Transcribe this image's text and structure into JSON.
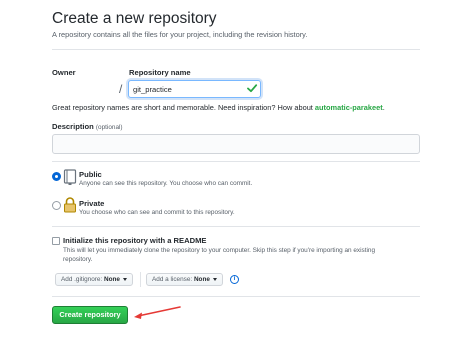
{
  "header": {
    "title": "Create a new repository",
    "subtitle": "A repository contains all the files for your project, including the revision history."
  },
  "owner": {
    "label": "Owner"
  },
  "repository": {
    "label": "Repository name",
    "separator": "/",
    "value": "git_practice",
    "hint_prefix": "Great repository names are short and memorable. Need inspiration? How about ",
    "suggestion": "automatic-parakeet",
    "hint_suffix": "."
  },
  "description": {
    "label": "Description",
    "optional": "(optional)",
    "value": ""
  },
  "visibility": {
    "selected": "public",
    "options": [
      {
        "title": "Public",
        "desc": "Anyone can see this repository. You choose who can commit."
      },
      {
        "title": "Private",
        "desc": "You choose who can see and commit to this repository."
      }
    ]
  },
  "readme": {
    "checked": false,
    "label": "Initialize this repository with a README",
    "desc": "This will let you immediately clone the repository to your computer. Skip this step if you're importing an existing repository."
  },
  "dropdowns": {
    "gitignore_prefix": "Add .gitignore:",
    "gitignore_value": "None",
    "license_prefix": "Add a license:",
    "license_value": "None"
  },
  "info_icon": {
    "glyph": "i"
  },
  "actions": {
    "create_label": "Create repository"
  },
  "colors": {
    "primary_button": "#28a745",
    "suggestion": "#28a745",
    "focus_border": "#79b8ff",
    "arrow": "#e53935"
  }
}
